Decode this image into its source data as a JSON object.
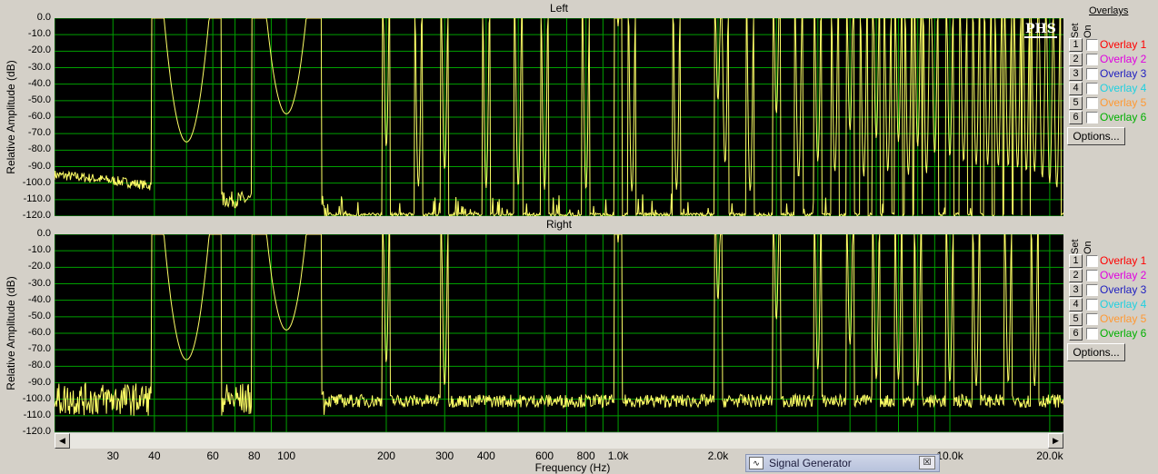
{
  "plots": [
    {
      "title": "Left",
      "ylabel": "Relative Amplitude (dB)",
      "series": "left"
    },
    {
      "title": "Right",
      "ylabel": "Relative Amplitude (dB)",
      "series": "right"
    }
  ],
  "yticks": [
    "0.0",
    "-10.0",
    "-20.0",
    "-30.0",
    "-40.0",
    "-50.0",
    "-60.0",
    "-70.0",
    "-80.0",
    "-90.0",
    "-100.0",
    "-110.0",
    "-120.0"
  ],
  "xticks": [
    {
      "label": "30",
      "hz": 30
    },
    {
      "label": "40",
      "hz": 40
    },
    {
      "label": "60",
      "hz": 60
    },
    {
      "label": "80",
      "hz": 80
    },
    {
      "label": "100",
      "hz": 100
    },
    {
      "label": "200",
      "hz": 200
    },
    {
      "label": "300",
      "hz": 300
    },
    {
      "label": "400",
      "hz": 400
    },
    {
      "label": "600",
      "hz": 600
    },
    {
      "label": "800",
      "hz": 800
    },
    {
      "label": "1.0k",
      "hz": 1000
    },
    {
      "label": "2.0k",
      "hz": 2000
    },
    {
      "label": "10.0k",
      "hz": 10000
    },
    {
      "label": "20.0k",
      "hz": 20000
    }
  ],
  "xlabel": "Frequency (Hz)",
  "overlays": {
    "title": "Overlays",
    "col_set": "Set",
    "col_on": "On",
    "items": [
      {
        "set": "1",
        "name": "Overlay 1",
        "color": "#ff0000"
      },
      {
        "set": "2",
        "name": "Overlay 2",
        "color": "#e000e0"
      },
      {
        "set": "3",
        "name": "Overlay 3",
        "color": "#2020c0"
      },
      {
        "set": "4",
        "name": "Overlay 4",
        "color": "#20d0e0"
      },
      {
        "set": "5",
        "name": "Overlay 5",
        "color": "#ff9933"
      },
      {
        "set": "6",
        "name": "Overlay 6",
        "color": "#00b000"
      }
    ],
    "options_label": "Options..."
  },
  "logo": "PHS",
  "signal_generator": {
    "title": "Signal Generator",
    "close": "☒"
  },
  "colors": {
    "trace": "#ffff66",
    "grid": "#00a000",
    "background": "#000000"
  },
  "chart_data": {
    "type": "line",
    "xscale": "log",
    "xlim": [
      20,
      22000
    ],
    "ylim": [
      -120,
      0
    ],
    "xlabel": "Frequency (Hz)",
    "ylabel": "Relative Amplitude (dB)",
    "series": [
      {
        "name": "Left",
        "peaks": [
          [
            50,
            -75
          ],
          [
            100,
            -58
          ],
          [
            200,
            -78
          ],
          [
            250,
            -102
          ],
          [
            300,
            -92
          ],
          [
            400,
            -103
          ],
          [
            500,
            -102
          ],
          [
            600,
            -104
          ],
          [
            800,
            -104
          ],
          [
            1000,
            -5
          ],
          [
            1100,
            -105
          ],
          [
            1500,
            -104
          ],
          [
            2000,
            -50
          ],
          [
            2100,
            -88
          ],
          [
            2500,
            -105
          ],
          [
            3000,
            -58
          ],
          [
            3500,
            -97
          ],
          [
            4000,
            -87
          ],
          [
            4500,
            -93
          ],
          [
            5000,
            -68
          ],
          [
            5500,
            -96
          ],
          [
            6000,
            -73
          ],
          [
            6500,
            -93
          ],
          [
            7000,
            -75
          ],
          [
            7500,
            -95
          ],
          [
            8000,
            -78
          ],
          [
            8500,
            -94
          ],
          [
            9000,
            -82
          ],
          [
            10000,
            -84
          ],
          [
            11000,
            -87
          ],
          [
            12000,
            -89
          ],
          [
            13000,
            -89
          ],
          [
            14000,
            -90
          ],
          [
            15000,
            -90
          ],
          [
            16000,
            -91
          ],
          [
            17000,
            -93
          ],
          [
            18000,
            -93
          ],
          [
            19000,
            -97
          ],
          [
            20000,
            -100
          ],
          [
            21000,
            -103
          ]
        ],
        "floor_db": -118
      },
      {
        "name": "Right",
        "peaks": [
          [
            50,
            -76
          ],
          [
            100,
            -58
          ],
          [
            200,
            -78
          ],
          [
            300,
            -92
          ],
          [
            1000,
            -5
          ],
          [
            2000,
            -40
          ],
          [
            3000,
            -52
          ],
          [
            4000,
            -82
          ],
          [
            5000,
            -67
          ],
          [
            6000,
            -88
          ],
          [
            7000,
            -88
          ],
          [
            8000,
            -92
          ],
          [
            10000,
            -90
          ],
          [
            12000,
            -92
          ],
          [
            15000,
            -90
          ],
          [
            18000,
            -92
          ]
        ],
        "floor_db": -100
      }
    ]
  }
}
